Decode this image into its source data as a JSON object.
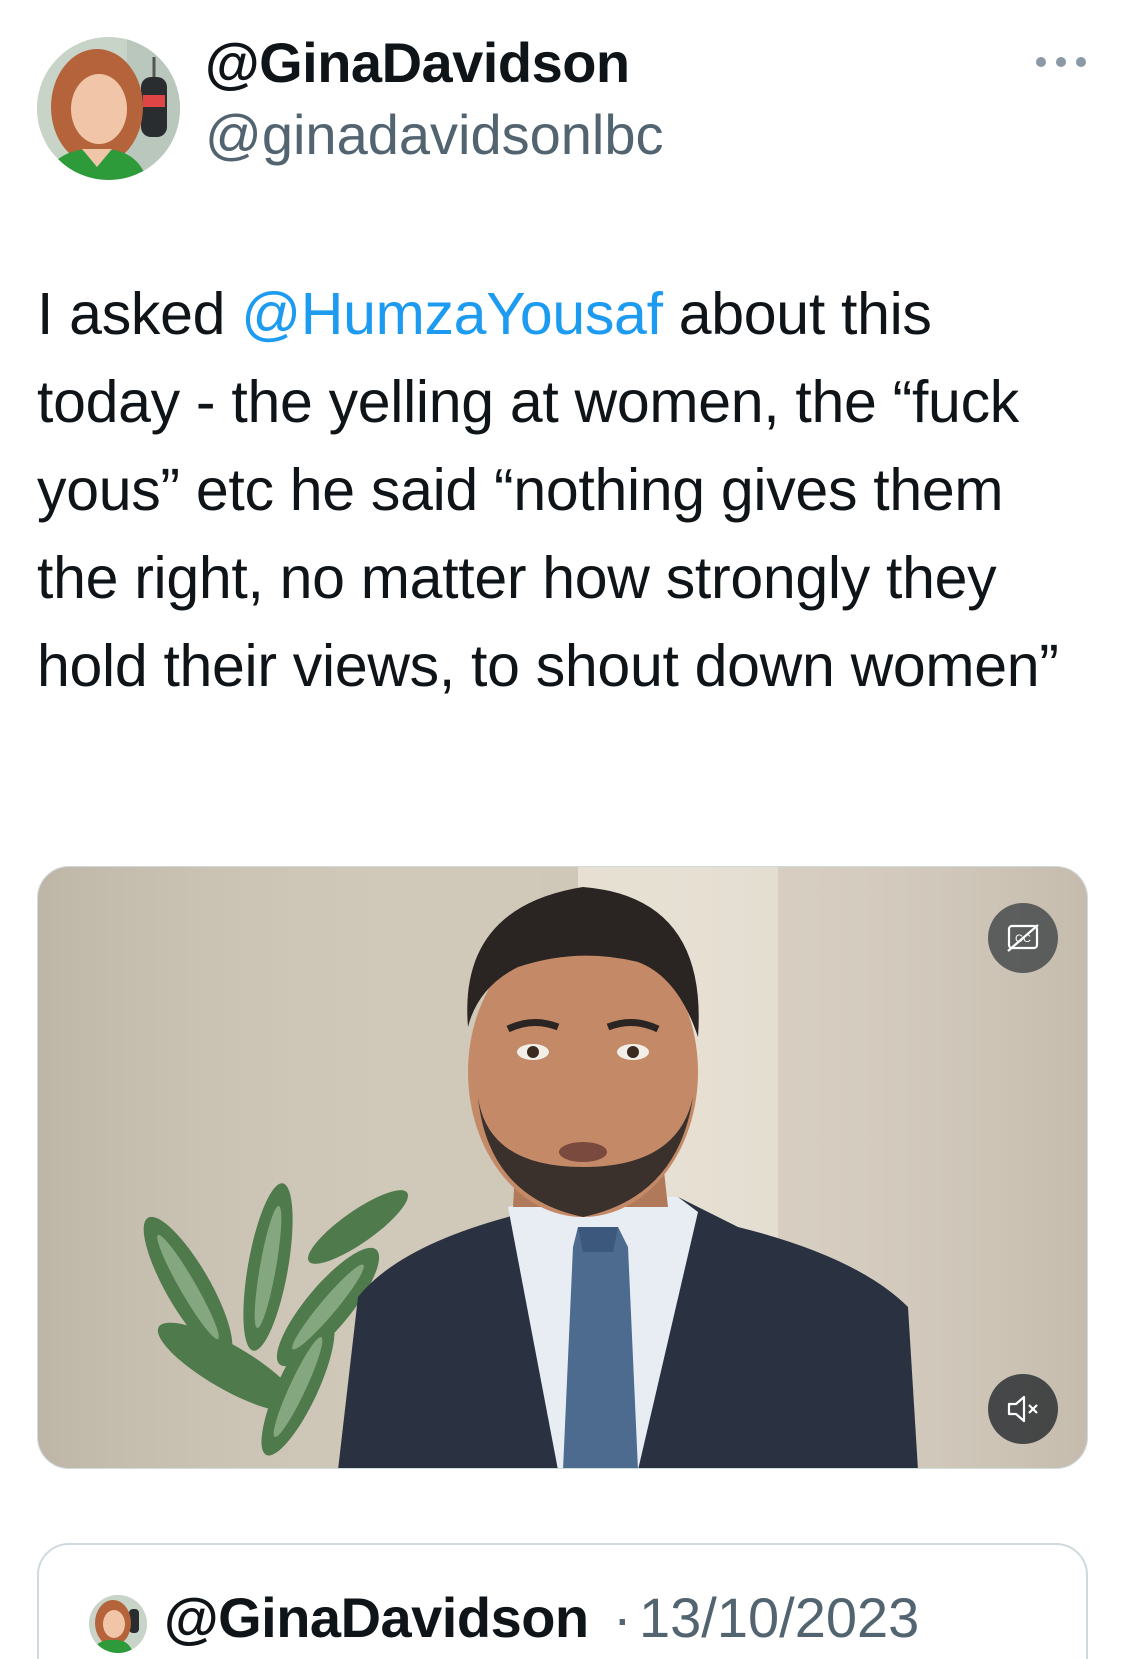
{
  "author": {
    "display_name": "@GinaDavidson",
    "handle": "@ginadavidsonlbc"
  },
  "tweet": {
    "text_before": "I asked ",
    "mention": "@HumzaYousaf",
    "text_after": " about this today - the yelling at women, the “fuck yous” etc he said “nothing gives them the right, no matter how strongly they hold their views, to shout down women”"
  },
  "video": {
    "cc_icon": "captions-off-icon",
    "mute_icon": "volume-muted-icon"
  },
  "quoted_tweet": {
    "display_name": "@GinaDavidson",
    "separator": "·",
    "date": "13/10/2023"
  },
  "colors": {
    "text": "#0f1419",
    "secondary": "#536471",
    "link": "#1d9bf0",
    "border": "#cfd9de"
  }
}
